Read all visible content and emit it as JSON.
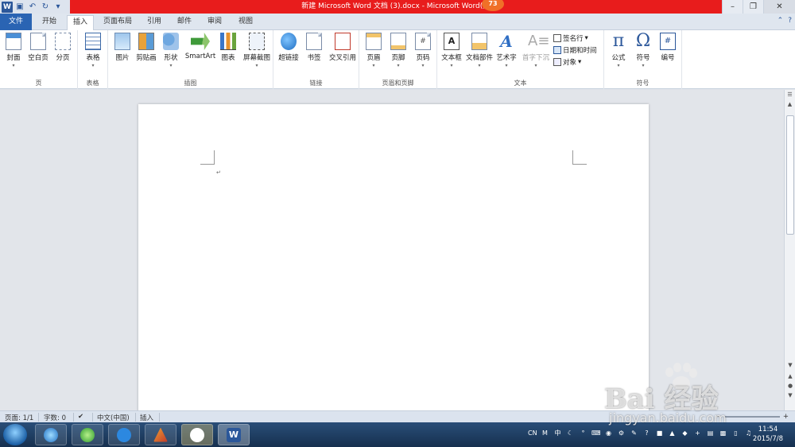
{
  "window": {
    "title": "新建 Microsoft Word 文档 (3).docx - Microsoft Word(产品",
    "title_tail": ")",
    "badge": "73"
  },
  "tabs": [
    {
      "label": "文件"
    },
    {
      "label": "开始"
    },
    {
      "label": "插入"
    },
    {
      "label": "页面布局"
    },
    {
      "label": "引用"
    },
    {
      "label": "邮件"
    },
    {
      "label": "审阅"
    },
    {
      "label": "视图"
    }
  ],
  "ribbon": {
    "pages": {
      "label": "页",
      "cover": "封面",
      "blank": "空白页",
      "break": "分页"
    },
    "tables": {
      "label": "表格",
      "table": "表格"
    },
    "illustrations": {
      "label": "插图",
      "picture": "图片",
      "clipart": "剪贴画",
      "shapes": "形状",
      "smartart": "SmartArt",
      "chart": "图表",
      "screenshot": "屏幕截图"
    },
    "links": {
      "label": "链接",
      "hyperlink": "超链接",
      "bookmark": "书签",
      "crossref": "交叉引用"
    },
    "header_footer": {
      "label": "页眉和页脚",
      "header": "页眉",
      "footer": "页脚",
      "pagenum": "页码"
    },
    "text": {
      "label": "文本",
      "textbox": "文本框",
      "quickparts": "文档部件",
      "wordart": "艺术字",
      "dropcap": "首字下沉",
      "signature": "签名行",
      "datetime": "日期和时间",
      "object": "对象"
    },
    "symbols": {
      "label": "符号",
      "equation": "公式",
      "symbol": "符号",
      "number": "编号"
    }
  },
  "status": {
    "page": "页面: 1/1",
    "words": "字数: 0",
    "lang": "中文(中国)",
    "mode": "插入"
  },
  "tray": {
    "ime": "CN",
    "time": "11:54",
    "date": "2015/7/8"
  },
  "watermark": {
    "brand": "Bai  经验",
    "url": "jingyan.baidu.com"
  }
}
